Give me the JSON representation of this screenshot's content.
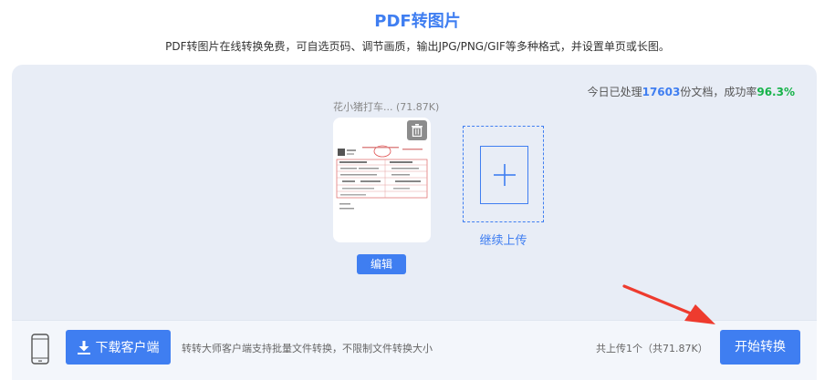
{
  "header": {
    "title": "PDF转图片",
    "subtitle": "PDF转图片在线转换免费，可自选页码、调节画质，输出JPG/PNG/GIF等多种格式，并设置单页或长图。"
  },
  "stats": {
    "prefix": "今日已处理",
    "count": "17603",
    "middle": "份文档，成功率",
    "rate": "96.3%"
  },
  "file": {
    "name": "花小猪打车... (71.87K)",
    "edit_label": "编辑",
    "delete_icon": "trash-icon"
  },
  "upload": {
    "label": "继续上传",
    "icon": "plus-icon"
  },
  "bottom": {
    "download_label": "下载客户端",
    "client_note": "转转大师客户端支持批量文件转换，不限制文件转换大小",
    "upload_total": "共上传1个（共71.87K）",
    "start_label": "开始转换"
  },
  "colors": {
    "accent": "#3f7ef1",
    "success": "#17b34a",
    "annotation_arrow": "#ee3b2e"
  }
}
